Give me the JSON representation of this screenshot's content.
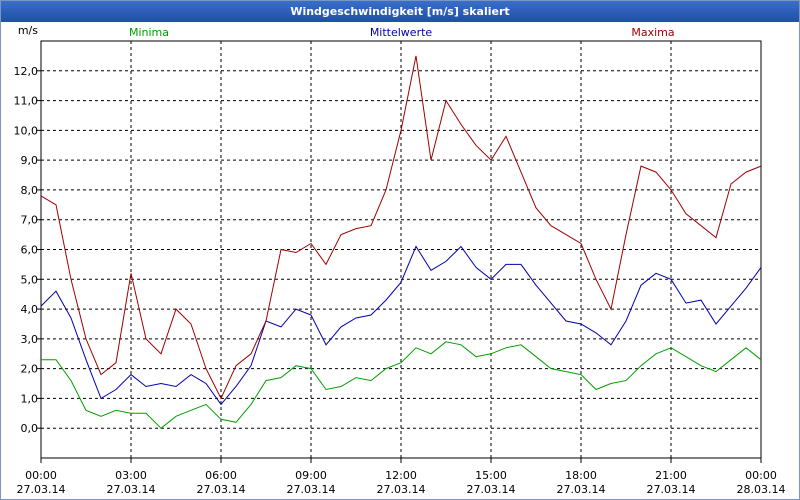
{
  "window": {
    "title": "Windgeschwindigkeit [m/s] skaliert"
  },
  "chart_data": {
    "type": "line",
    "title": "Windgeschwindigkeit [m/s] skaliert",
    "ylabel": "m/s",
    "ylim": [
      -1.0,
      13.0
    ],
    "xlim": [
      0,
      24
    ],
    "grid": true,
    "legend": "top",
    "y_ticks": [
      "0,0",
      "1,0",
      "2,0",
      "3,0",
      "4,0",
      "5,0",
      "6,0",
      "7,0",
      "8,0",
      "9,0",
      "10,0",
      "11,0",
      "12,0"
    ],
    "x_ticks": [
      {
        "time": "00:00",
        "date": "27.03.14"
      },
      {
        "time": "03:00",
        "date": "27.03.14"
      },
      {
        "time": "06:00",
        "date": "27.03.14"
      },
      {
        "time": "09:00",
        "date": "27.03.14"
      },
      {
        "time": "12:00",
        "date": "27.03.14"
      },
      {
        "time": "15:00",
        "date": "27.03.14"
      },
      {
        "time": "18:00",
        "date": "27.03.14"
      },
      {
        "time": "21:00",
        "date": "27.03.14"
      },
      {
        "time": "00:00",
        "date": "28.03.14"
      }
    ],
    "x": [
      0.0,
      0.5,
      1.0,
      1.5,
      2.0,
      2.5,
      3.0,
      3.5,
      4.0,
      4.5,
      5.0,
      5.5,
      6.0,
      6.5,
      7.0,
      7.5,
      8.0,
      8.5,
      9.0,
      9.5,
      10.0,
      10.5,
      11.0,
      11.5,
      12.0,
      12.5,
      13.0,
      13.5,
      14.0,
      14.5,
      15.0,
      15.5,
      16.0,
      16.5,
      17.0,
      17.5,
      18.0,
      18.5,
      19.0,
      19.5,
      20.0,
      20.5,
      21.0,
      21.5,
      22.0,
      22.5,
      23.0,
      23.5,
      24.0
    ],
    "series": [
      {
        "name": "Minima",
        "color": "#00a000",
        "values": [
          2.3,
          2.3,
          1.6,
          0.6,
          0.4,
          0.6,
          0.5,
          0.5,
          0.0,
          0.4,
          0.6,
          0.8,
          0.3,
          0.2,
          0.8,
          1.6,
          1.7,
          2.1,
          2.0,
          1.3,
          1.4,
          1.7,
          1.6,
          2.0,
          2.2,
          2.7,
          2.5,
          2.9,
          2.8,
          2.4,
          2.5,
          2.7,
          2.8,
          2.4,
          2.0,
          1.9,
          1.8,
          1.3,
          1.5,
          1.6,
          2.1,
          2.5,
          2.7,
          2.4,
          2.1,
          1.9,
          2.3,
          2.7,
          2.3
        ]
      },
      {
        "name": "Mittelwerte",
        "color": "#0000b0",
        "values": [
          4.1,
          4.6,
          3.7,
          2.3,
          1.0,
          1.3,
          1.8,
          1.4,
          1.5,
          1.4,
          1.8,
          1.5,
          0.8,
          1.4,
          2.1,
          3.6,
          3.4,
          4.0,
          3.8,
          2.8,
          3.4,
          3.7,
          3.8,
          4.3,
          4.9,
          6.1,
          5.3,
          5.6,
          6.1,
          5.4,
          5.0,
          5.5,
          5.5,
          4.8,
          4.2,
          3.6,
          3.5,
          3.2,
          2.8,
          3.6,
          4.8,
          5.2,
          5.0,
          4.2,
          4.3,
          3.5,
          4.1,
          4.7,
          5.4
        ]
      },
      {
        "name": "Maxima",
        "color": "#a00000",
        "values": [
          7.8,
          7.5,
          5.0,
          3.0,
          1.8,
          2.2,
          5.2,
          3.0,
          2.5,
          4.0,
          3.5,
          2.0,
          1.0,
          2.1,
          2.5,
          3.6,
          6.0,
          5.9,
          6.2,
          5.5,
          6.5,
          6.7,
          6.8,
          8.0,
          10.0,
          12.5,
          9.0,
          11.0,
          10.2,
          9.5,
          9.0,
          9.8,
          8.6,
          7.4,
          6.8,
          6.5,
          6.2,
          5.0,
          4.0,
          6.5,
          8.8,
          8.6,
          8.0,
          7.2,
          6.8,
          6.4,
          8.2,
          8.6,
          8.8
        ]
      }
    ]
  }
}
